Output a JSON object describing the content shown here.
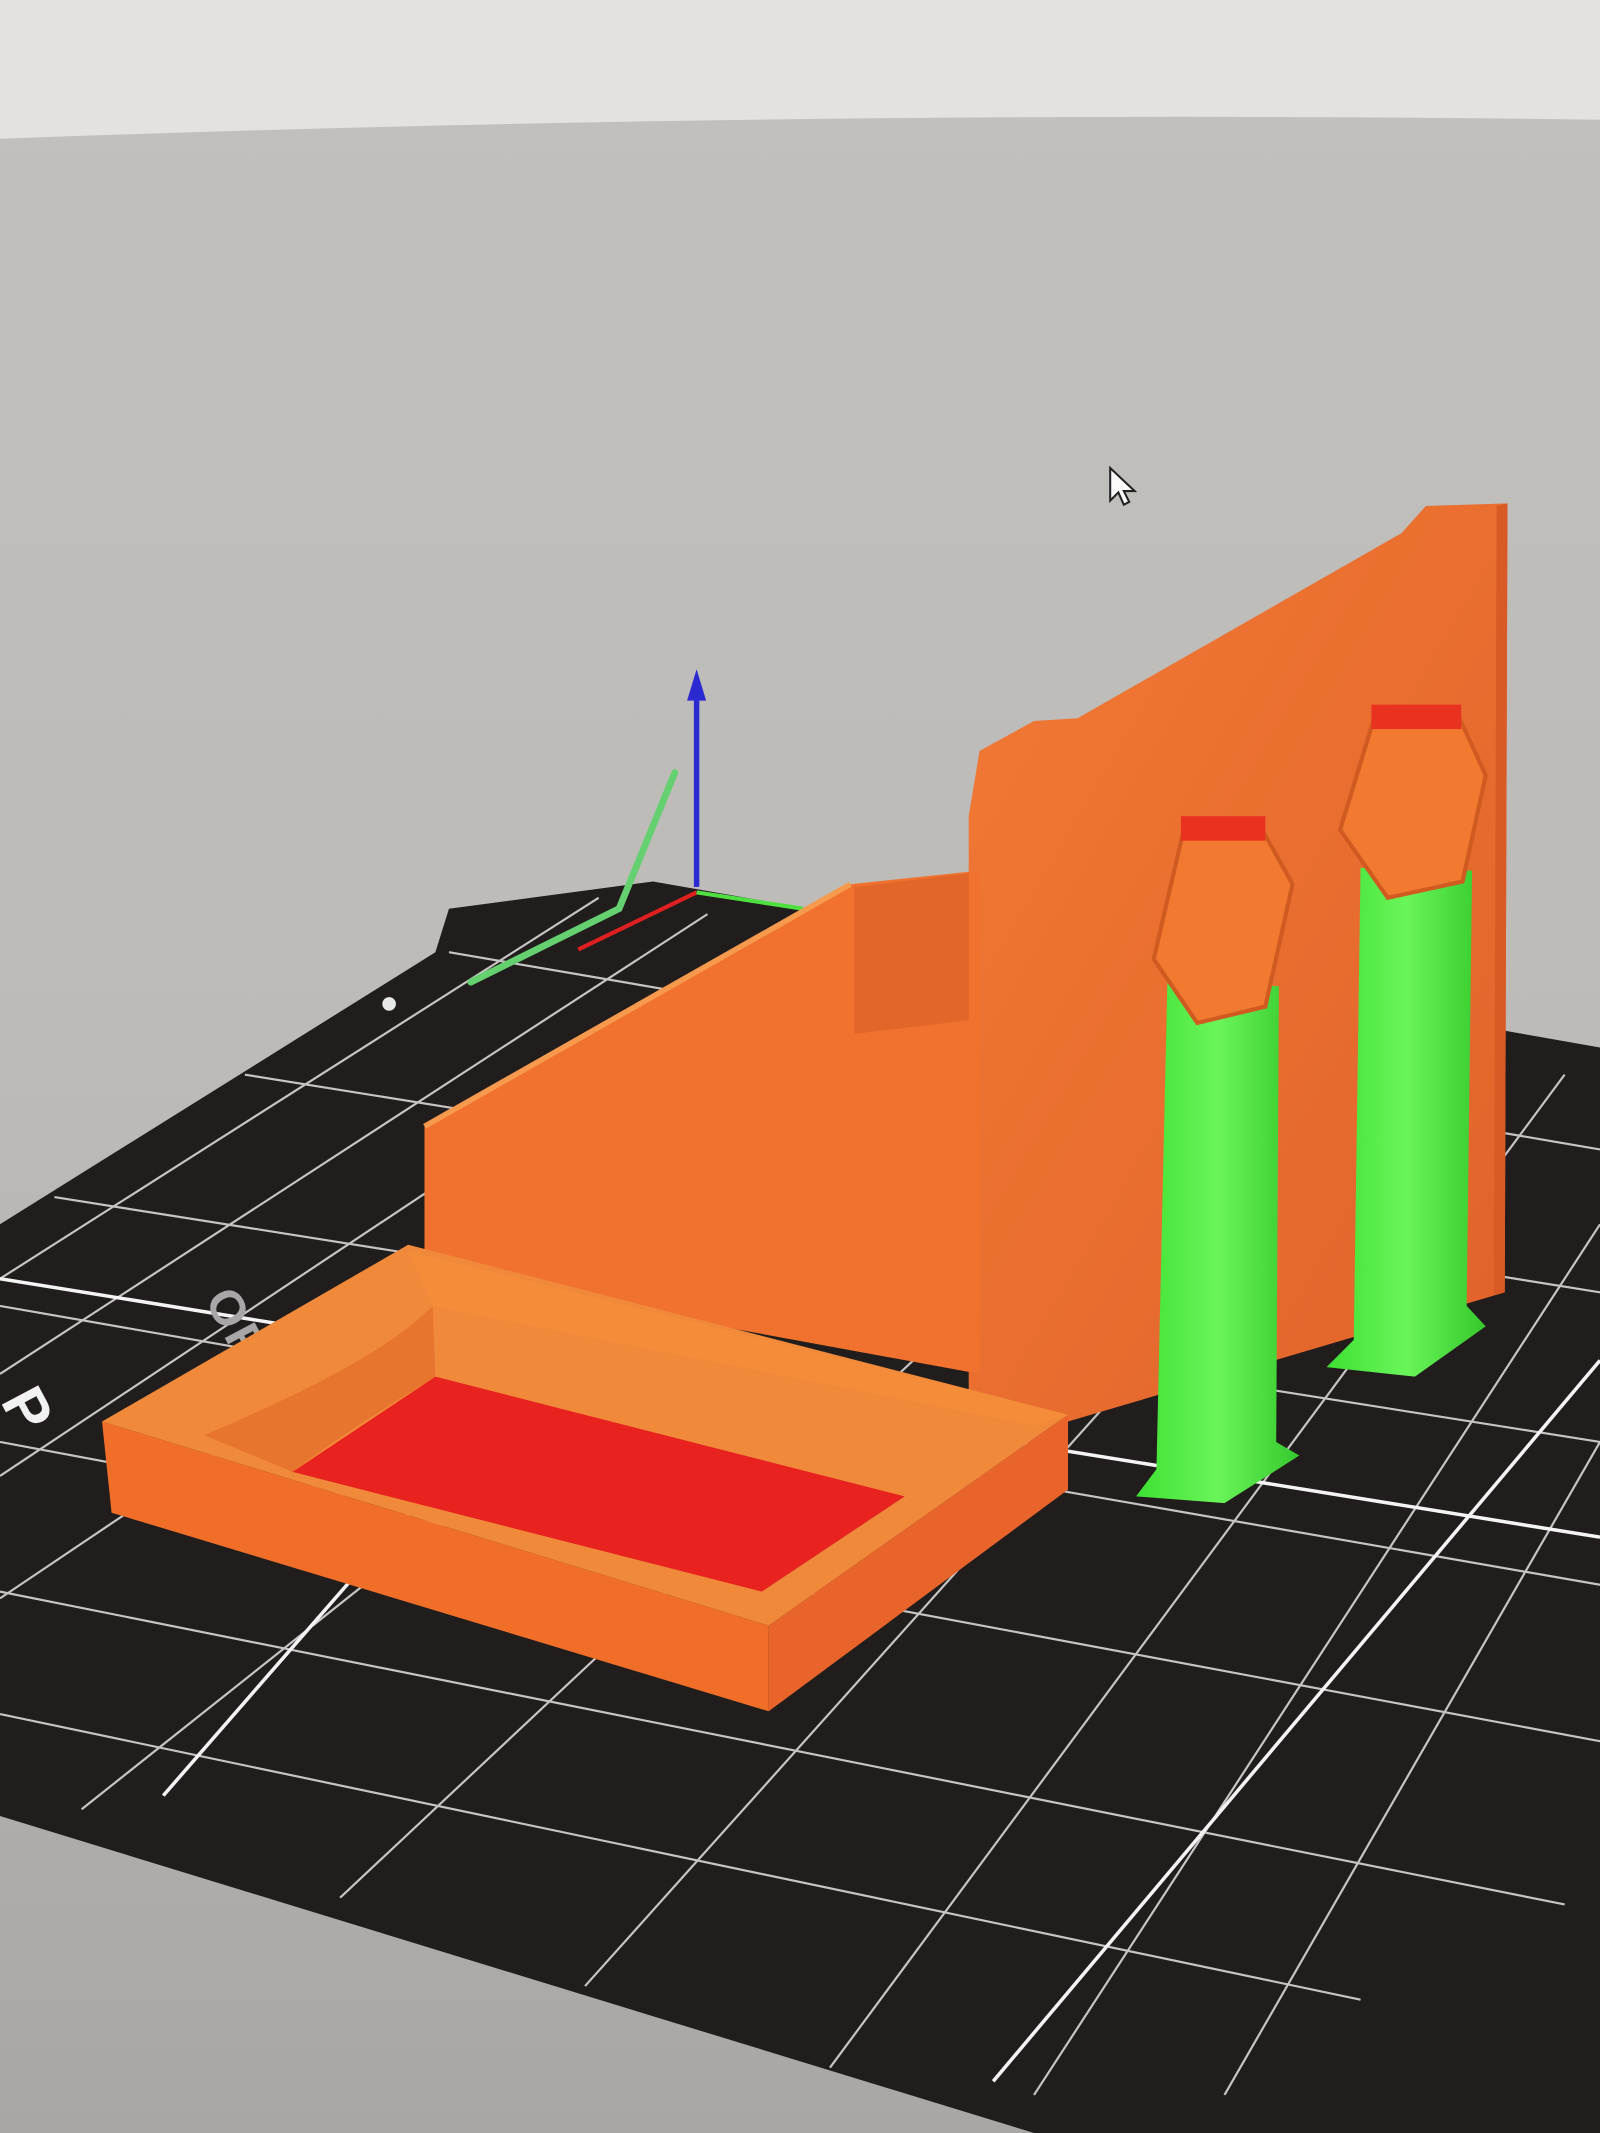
{
  "viewport": {
    "view_mode": "slicer-preview",
    "colors": {
      "background_top": "#e6e4e1",
      "background": "#b9b7b4",
      "bed": "#201c1c",
      "grid": "#d8d6d6",
      "perimeter": "#f0702a",
      "top_solid": "#e8231f",
      "support": "#4df03a",
      "axis_x": "#e02020",
      "axis_y": "#5fd06a",
      "axis_z": "#2a2ad0"
    }
  },
  "bed_label": {
    "line1": "ORIGINAL",
    "line2": "P"
  }
}
